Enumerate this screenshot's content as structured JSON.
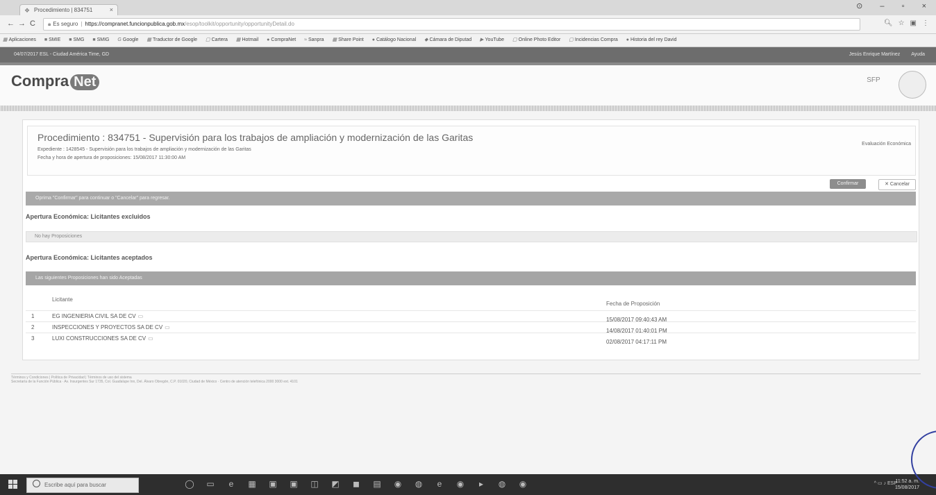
{
  "browser": {
    "tab_title": "Procedimiento | 834751",
    "window_controls": [
      "⊙",
      "–",
      "▫",
      "×"
    ],
    "secure_label": "Es seguro",
    "url_host": "https://compranet.funcionpublica.gob.mx",
    "url_path": "/esop/toolkit/opportunity/opportunityDetail.do",
    "bookmarks": [
      "Aplicaciones",
      "SMIE",
      "SMG",
      "SMIG",
      "Google",
      "Traductor de Google",
      "Cartera",
      "Hotmail",
      "CompraNet",
      "Sanpra",
      "Share Point",
      "Catálogo Nacional",
      "Cámara de Diputad",
      "YouTube",
      "Online Photo Editor",
      "Incidencias Compra",
      "Historia del rey David"
    ]
  },
  "appbar": {
    "left": "04/07/2017 ESL - Ciudad América Time, GD",
    "right": [
      "Jesús Enrique Martínez",
      "Ayuda"
    ]
  },
  "header": {
    "logo_text": "Compra",
    "logo_net": "Net",
    "sfp_label": "SFP"
  },
  "procedure": {
    "title": "Procedimiento : 834751 - Supervisión para los trabajos de ampliación y modernización de las Garitas",
    "expediente": "Expediente : 1428545 - Supervisión para los trabajos de ampliación y modernización de las Garitas",
    "fecha": "Fecha y hora de apertura de proposiciones: 15/08/2017 11:30:00 AM",
    "doc_button": "Evaluación Económica"
  },
  "actions": {
    "confirm": "Confirmar",
    "cancel": "Cancelar"
  },
  "notice": "Oprima \"Confirmar\" para continuar o \"Cancelar\" para regresar.",
  "section_excluded": {
    "title": "Apertura Económica: Licitantes excluidos",
    "strip": "No hay Proposiciones"
  },
  "section_accepted": {
    "title": "Apertura Económica: Licitantes aceptados",
    "strip": "Las siguientes Proposiciones han sido Aceptadas"
  },
  "table": {
    "headers": {
      "licitante": "Licitante",
      "fecha": "Fecha de Proposición"
    },
    "rows": [
      {
        "num": "1",
        "licitante": "EG INGENIERIA CIVIL SA DE CV",
        "fecha": "15/08/2017 09:40:43 AM"
      },
      {
        "num": "2",
        "licitante": "INSPECCIONES Y PROYECTOS SA DE CV",
        "fecha": "14/08/2017 01:40:01 PM"
      },
      {
        "num": "3",
        "licitante": "LUXI CONSTRUCCIONES SA DE CV",
        "fecha": "02/08/2017 04:17:11 PM"
      }
    ]
  },
  "footer": {
    "line1": "Términos y Condiciones | Política de Privacidad | Términos de uso del sistema",
    "line2": "Secretaría de la Función Pública · Av. Insurgentes Sur 1735, Col. Guadalupe Inn, Del. Álvaro Obregón, C.P. 01020, Ciudad de México · Centro de atención telefónica 2000 3000 ext. 4101"
  },
  "taskbar": {
    "search_placeholder": "Escribe aquí para buscar",
    "icons": [
      "◯",
      "▭",
      "e",
      "▦",
      "▣",
      "▣",
      "◫",
      "◩",
      "◼",
      "▤",
      "◉",
      "◍",
      "e",
      "◉",
      "▸",
      "◍",
      "◉"
    ],
    "tray": "^ ▭ ♪ ESP",
    "clock_time": "11:52 a. m.",
    "clock_date": "15/08/2017"
  }
}
